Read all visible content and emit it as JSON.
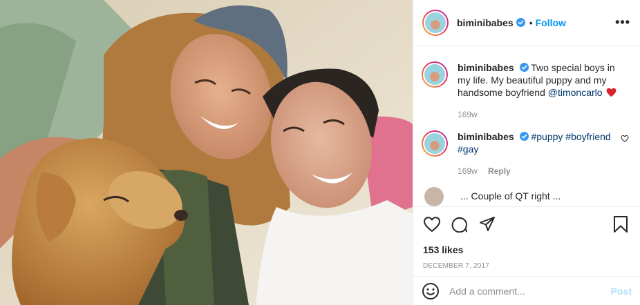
{
  "post": {
    "username": "biminibabes",
    "follow_label": "Follow",
    "more_label": "•••",
    "dot": "•",
    "photo_alt": "",
    "caption": {
      "username": "biminibabes",
      "text": "Two special boys in my life. My beautiful puppy and my handsome boyfriend ",
      "mention": "@timoncarlo",
      "time": "169w"
    },
    "comments": [
      {
        "username": "biminibabes",
        "hashtag_1": "#puppy",
        "hashtag_2": "#boyfriend",
        "hashtag_3": "#gay",
        "time": "169w",
        "reply_label": "Reply"
      }
    ],
    "partial_comment_text": "... Couple of QT right ...",
    "likes": "153 likes",
    "date": "DECEMBER 7, 2017",
    "add_comment_placeholder": "Add a comment...",
    "post_label": "Post",
    "colors": {
      "accent": "#0095f6",
      "link": "#00376b",
      "muted": "#8e8e8e",
      "post_disabled": "#b2dffc",
      "heart": "#ed4956"
    },
    "icons": [
      "heart-icon",
      "comment-icon",
      "share-icon",
      "bookmark-icon",
      "emoji-icon",
      "verified-icon",
      "more-icon"
    ]
  }
}
